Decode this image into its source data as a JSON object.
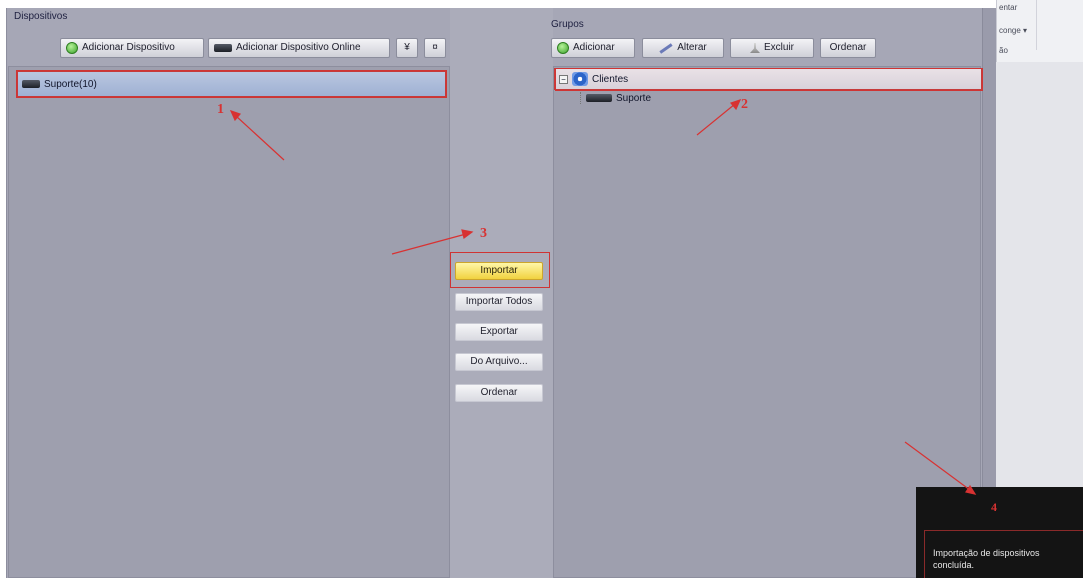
{
  "dispositivos": {
    "title": "Dispositivos",
    "add_device_label": "Adicionar Dispositivo",
    "add_online_label": "Adicionar Dispositivo Online",
    "expand_label": "¥",
    "collapse_label": "¤",
    "items": [
      {
        "label": "Suporte(10)",
        "selected": true
      }
    ]
  },
  "grupos": {
    "title": "Grupos",
    "add_label": "Adicionar",
    "edit_label": "Alterar",
    "delete_label": "Excluir",
    "sort_label": "Ordenar",
    "tree": {
      "root_label": "Clientes",
      "children": [
        {
          "label": "Suporte"
        }
      ]
    }
  },
  "middle": {
    "buttons": [
      "Importar",
      "Importar Todos",
      "Exportar",
      "Do Arquivo...",
      "Ordenar"
    ]
  },
  "annotations": [
    "1",
    "2",
    "3",
    "4"
  ],
  "right_strip": {
    "texts": [
      "entar",
      "conge ▾",
      "ão"
    ]
  },
  "toast": {
    "line1": "Importação de dispositivos",
    "line2": "concluída."
  },
  "colors": {
    "window_bg": "#a6a7b6",
    "list_bg": "#9e9fae",
    "selection_bg": "#b9c6e0",
    "highlight_red": "#cf3434",
    "primary_button": "#f1d23f",
    "toast_bg": "#141414"
  },
  "icons": [
    "plus-circle-icon",
    "device-icon",
    "pencil-icon",
    "brush-icon",
    "group-globe-icon",
    "tree-toggle-icon"
  ]
}
